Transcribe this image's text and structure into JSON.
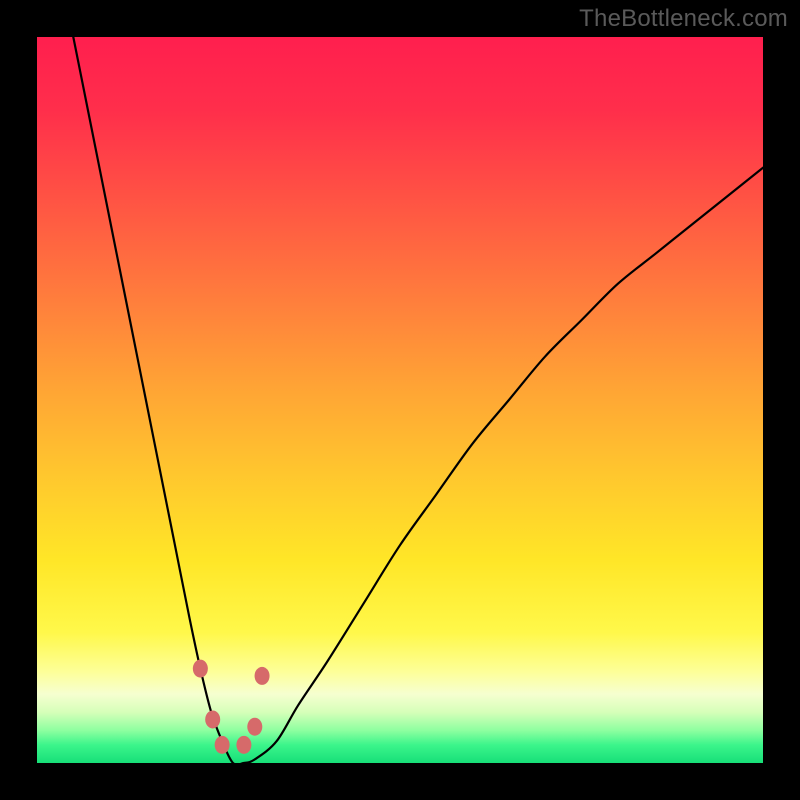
{
  "attribution": "TheBottleneck.com",
  "chart_data": {
    "type": "line",
    "title": "",
    "xlabel": "",
    "ylabel": "",
    "xlim": [
      0,
      100
    ],
    "ylim": [
      0,
      100
    ],
    "grid": false,
    "legend": false,
    "series": [
      {
        "name": "bottleneck-curve",
        "x": [
          5,
          7,
          9,
          11,
          13,
          15,
          17,
          19,
          21,
          22.5,
          24,
          25.5,
          27,
          28.5,
          30,
          33,
          36,
          40,
          45,
          50,
          55,
          60,
          65,
          70,
          75,
          80,
          85,
          90,
          95,
          100
        ],
        "y": [
          100,
          90,
          80,
          70,
          60,
          50,
          40,
          30,
          20,
          13,
          7,
          3,
          0,
          0,
          0.5,
          3,
          8,
          14,
          22,
          30,
          37,
          44,
          50,
          56,
          61,
          66,
          70,
          74,
          78,
          82
        ]
      }
    ],
    "markers": [
      {
        "x": 22.5,
        "y": 13
      },
      {
        "x": 24.2,
        "y": 6
      },
      {
        "x": 25.5,
        "y": 2.5
      },
      {
        "x": 28.5,
        "y": 2.5
      },
      {
        "x": 30.0,
        "y": 5
      },
      {
        "x": 31.0,
        "y": 12
      }
    ],
    "gradient_stops": [
      {
        "offset": 0.0,
        "color": "#ff1f4e"
      },
      {
        "offset": 0.1,
        "color": "#ff2e4b"
      },
      {
        "offset": 0.22,
        "color": "#ff5244"
      },
      {
        "offset": 0.35,
        "color": "#ff7a3d"
      },
      {
        "offset": 0.48,
        "color": "#ffa335"
      },
      {
        "offset": 0.6,
        "color": "#ffc62e"
      },
      {
        "offset": 0.72,
        "color": "#ffe627"
      },
      {
        "offset": 0.82,
        "color": "#fff84a"
      },
      {
        "offset": 0.875,
        "color": "#fdff9a"
      },
      {
        "offset": 0.905,
        "color": "#f6ffd0"
      },
      {
        "offset": 0.93,
        "color": "#d6ffb9"
      },
      {
        "offset": 0.955,
        "color": "#8effa0"
      },
      {
        "offset": 0.975,
        "color": "#3cf58b"
      },
      {
        "offset": 1.0,
        "color": "#17df78"
      }
    ],
    "marker_color": "#d66a6a",
    "curve_color": "#000000"
  }
}
